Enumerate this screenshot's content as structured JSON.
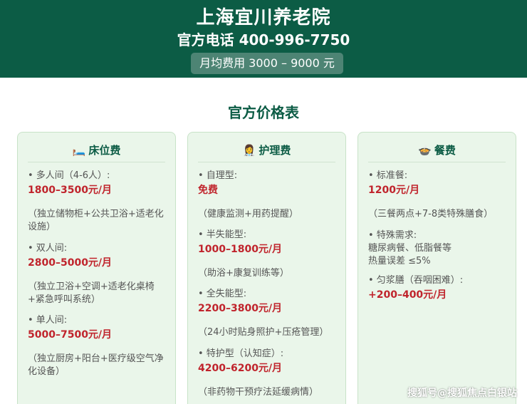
{
  "header": {
    "title": "上海宜川养老院",
    "phone": "官方电话 400-996-7750",
    "fee": "月均费用 3000 – 9000 元"
  },
  "section_title": "官方价格表",
  "cards": [
    {
      "icon": "🛏️",
      "title": "床位费",
      "items": [
        {
          "label": "• 多人间（4-6人）:",
          "price": "1800–3500元/月",
          "note": "（独立储物柜+公共卫浴+适老化设施）"
        },
        {
          "label": "• 双人间:",
          "price": "2800–5000元/月",
          "note": "（独立卫浴+空调+适老化桌椅+紧急呼叫系统）"
        },
        {
          "label": "• 单人间:",
          "price": "5000–7500元/月",
          "note": "（独立厨房+阳台+医疗级空气净化设备）"
        }
      ]
    },
    {
      "icon": "👩‍⚕️",
      "title": "护理费",
      "items": [
        {
          "label": "• 自理型:",
          "price": "免费",
          "note": "（健康监测+用药提醒）"
        },
        {
          "label": "• 半失能型:",
          "price": "1000–1800元/月",
          "note": "（助浴+康复训练等）"
        },
        {
          "label": "• 全失能型:",
          "price": "2200–3800元/月",
          "note": "（24小时贴身照护+压疮管理）"
        },
        {
          "label": "• 特护型（认知症）:",
          "price": "4200–6200元/月",
          "note": "（非药物干预疗法延缓病情）"
        }
      ]
    },
    {
      "icon": "🍲",
      "title": "餐费",
      "items": [
        {
          "label": "• 标准餐:",
          "price": "1200元/月",
          "note": "（三餐两点+7-8类特殊膳食）"
        },
        {
          "label": "• 特殊需求:",
          "line2": "糖尿病餐、低脂餐等",
          "line3": "热量误差 ≤5%"
        },
        {
          "label": "• 匀浆膳（吞咽困难）:",
          "price": "+200–400元/月"
        }
      ]
    }
  ],
  "watermark": "搜狐号@搜狐焦点白银站"
}
